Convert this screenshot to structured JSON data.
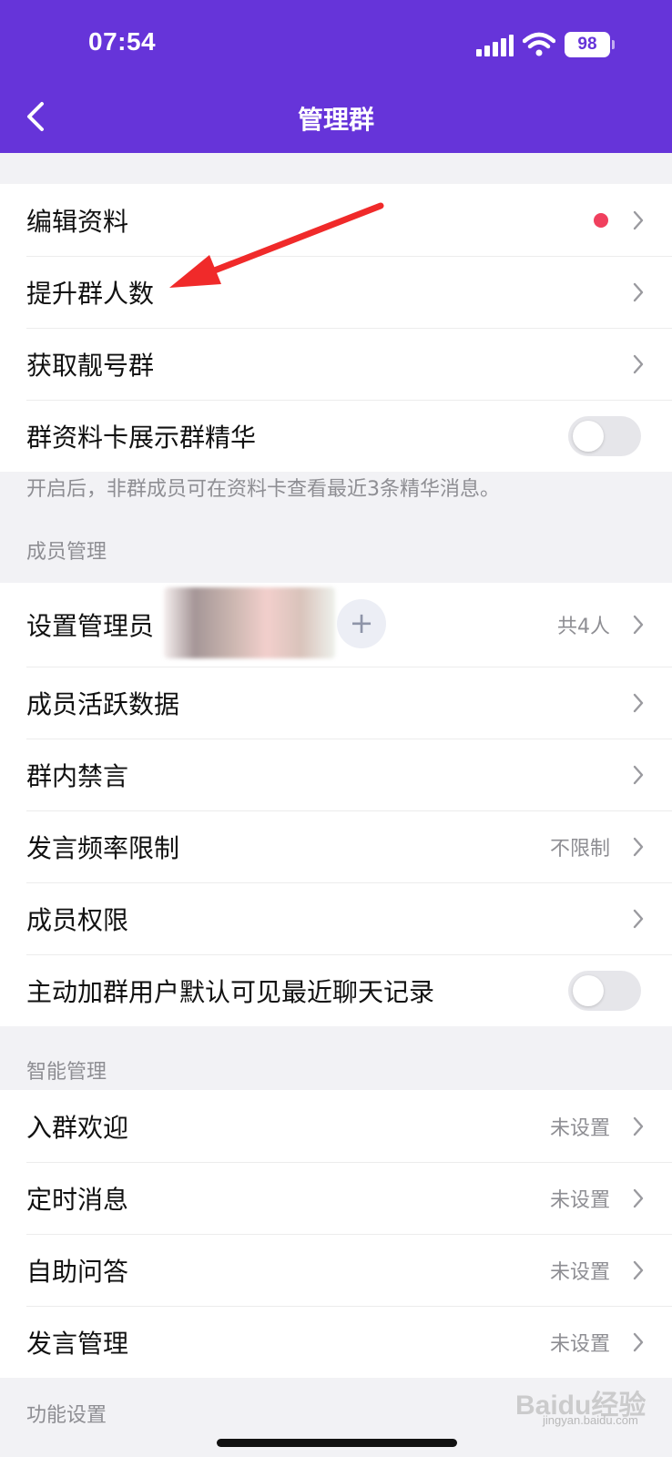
{
  "status_bar": {
    "time": "07:54",
    "battery": "98"
  },
  "nav": {
    "title": "管理群"
  },
  "group1": {
    "rows": [
      {
        "label": "编辑资料"
      },
      {
        "label": "提升群人数"
      },
      {
        "label": "获取靓号群"
      },
      {
        "label": "群资料卡展示群精华"
      }
    ],
    "note": "开启后，非群成员可在资料卡查看最近3条精华消息。"
  },
  "members": {
    "section_title": "成员管理",
    "rows": [
      {
        "label": "设置管理员",
        "value": "共4人",
        "add": "+"
      },
      {
        "label": "成员活跃数据"
      },
      {
        "label": "群内禁言"
      },
      {
        "label": "发言频率限制",
        "value": "不限制"
      },
      {
        "label": "成员权限"
      },
      {
        "label": "主动加群用户默认可见最近聊天记录"
      }
    ]
  },
  "smart": {
    "section_title": "智能管理",
    "rows": [
      {
        "label": "入群欢迎",
        "value": "未设置"
      },
      {
        "label": "定时消息",
        "value": "未设置"
      },
      {
        "label": "自助问答",
        "value": "未设置"
      },
      {
        "label": "发言管理",
        "value": "未设置"
      }
    ]
  },
  "features": {
    "section_title": "功能设置"
  },
  "watermark": {
    "brand": "Baidu经验",
    "url": "jingyan.baidu.com"
  },
  "colors": {
    "header": "#6634d9",
    "red_dot": "#f0405e",
    "arrow": "#f02a2a"
  },
  "toggles": {
    "group_essence": false,
    "show_recent_history": false
  },
  "icons": [
    "back-icon",
    "chevron-right-icon",
    "signal-icon",
    "wifi-icon",
    "battery-icon",
    "plus-icon",
    "red-dot-icon"
  ]
}
